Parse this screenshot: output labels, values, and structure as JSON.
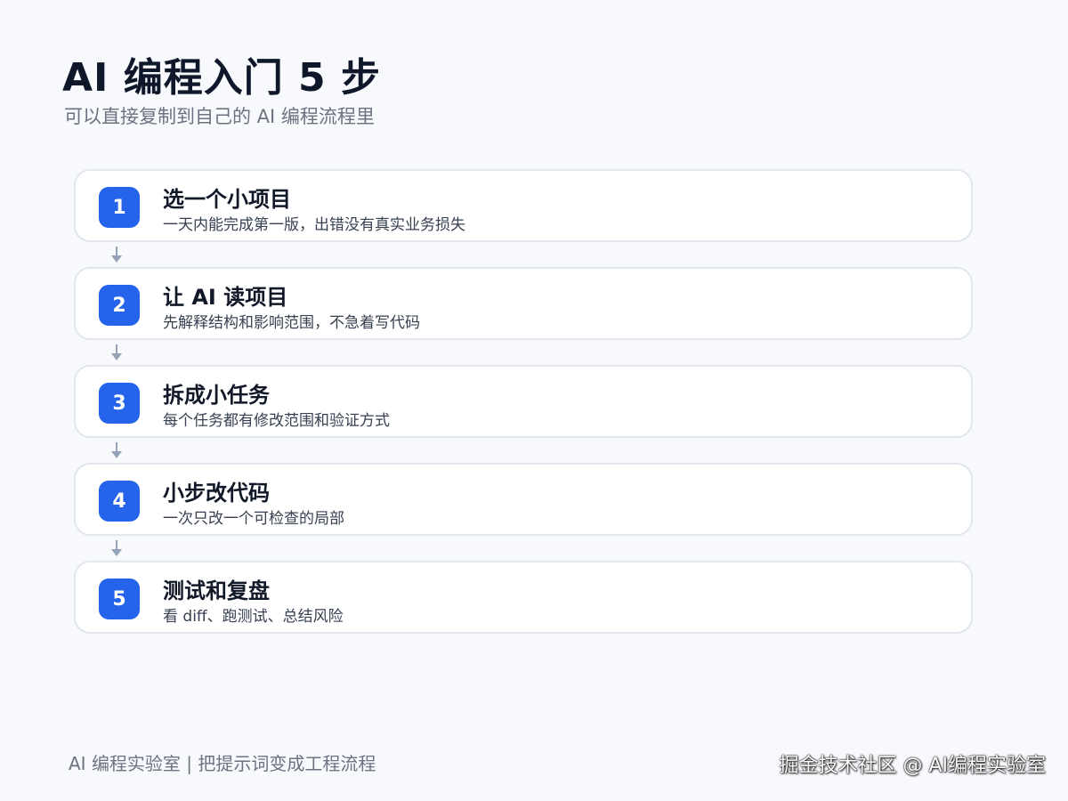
{
  "header": {
    "title": "AI 编程入门 5 步",
    "subtitle": "可以直接复制到自己的 AI 编程流程里"
  },
  "steps": [
    {
      "number": "1",
      "title": "选一个小项目",
      "description": "一天内能完成第一版，出错没有真实业务损失"
    },
    {
      "number": "2",
      "title": "让 AI 读项目",
      "description": "先解释结构和影响范围，不急着写代码"
    },
    {
      "number": "3",
      "title": "拆成小任务",
      "description": "每个任务都有修改范围和验证方式"
    },
    {
      "number": "4",
      "title": "小步改代码",
      "description": "一次只改一个可检查的局部"
    },
    {
      "number": "5",
      "title": "测试和复盘",
      "description": "看 diff、跑测试、总结风险"
    }
  ],
  "footer": {
    "left": "AI 编程实验室 | 把提示词变成工程流程",
    "watermark": "掘金技术社区 @ AI编程实验室"
  },
  "colors": {
    "accent": "#2563eb",
    "background": "#f7f9fc",
    "card": "#ffffff",
    "card_border": "#e2e7ee",
    "connector": "#94a3b8"
  },
  "icons": {
    "connector": "arrow-down-icon"
  }
}
